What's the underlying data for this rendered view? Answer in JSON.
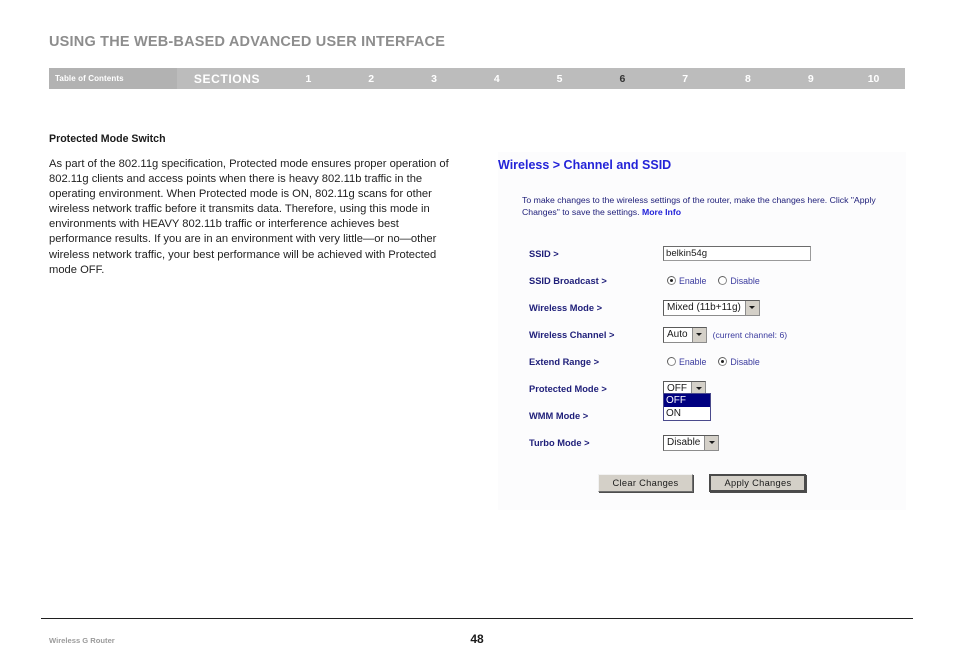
{
  "document": {
    "header_title": "USING THE WEB-BASED ADVANCED USER INTERFACE",
    "nav": {
      "toc_label": "Table of Contents",
      "sections_label": "SECTIONS",
      "numbers": [
        "1",
        "2",
        "3",
        "4",
        "5",
        "6",
        "7",
        "8",
        "9",
        "10"
      ],
      "active_number": "6"
    },
    "footer": {
      "product": "Wireless G Router",
      "page_number": "48"
    }
  },
  "article": {
    "subheading": "Protected Mode Switch",
    "paragraph": "As part of the 802.11g specification, Protected mode ensures proper operation of 802.11g clients and access points when there is heavy 802.11b traffic in the operating environment. When Protected mode is ON, 802.11g scans for other wireless network traffic before it transmits data. Therefore, using this mode in environments with HEAVY 802.11b traffic or interference achieves best performance results. If you are in an environment with very little—or no—other wireless network traffic, your best performance will be achieved with Protected mode OFF."
  },
  "router_ui": {
    "heading": "Wireless > Channel and SSID",
    "description_before_link": "To make changes to the wireless settings of the router, make the changes here. Click \"Apply Changes\" to save the settings. ",
    "more_info_link": "More Info",
    "fields": {
      "ssid": {
        "label": "SSID >",
        "value": "belkin54g"
      },
      "ssid_broadcast": {
        "label": "SSID Broadcast >",
        "enable_label": "Enable",
        "disable_label": "Disable",
        "selected": "Enable"
      },
      "wireless_mode": {
        "label": "Wireless Mode >",
        "value": "Mixed (11b+11g)"
      },
      "wireless_channel": {
        "label": "Wireless Channel >",
        "value": "Auto",
        "note": "(current channel: 6)"
      },
      "extend_range": {
        "label": "Extend Range >",
        "enable_label": "Enable",
        "disable_label": "Disable",
        "selected": "Disable"
      },
      "protected_mode": {
        "label": "Protected Mode >",
        "value": "OFF",
        "open": true,
        "options": [
          "OFF",
          "ON"
        ],
        "highlighted_option": "OFF"
      },
      "wmm_mode": {
        "label": "WMM Mode >"
      },
      "turbo_mode": {
        "label": "Turbo Mode >",
        "value": "Disable"
      }
    },
    "buttons": {
      "clear": "Clear Changes",
      "apply": "Apply Changes"
    }
  },
  "colors": {
    "nav_bar": "#bcbcbc",
    "nav_toc_cell": "#b2b2b2",
    "router_heading": "#2323d8",
    "router_label": "#20207a",
    "dropdown_highlight": "#000080"
  }
}
